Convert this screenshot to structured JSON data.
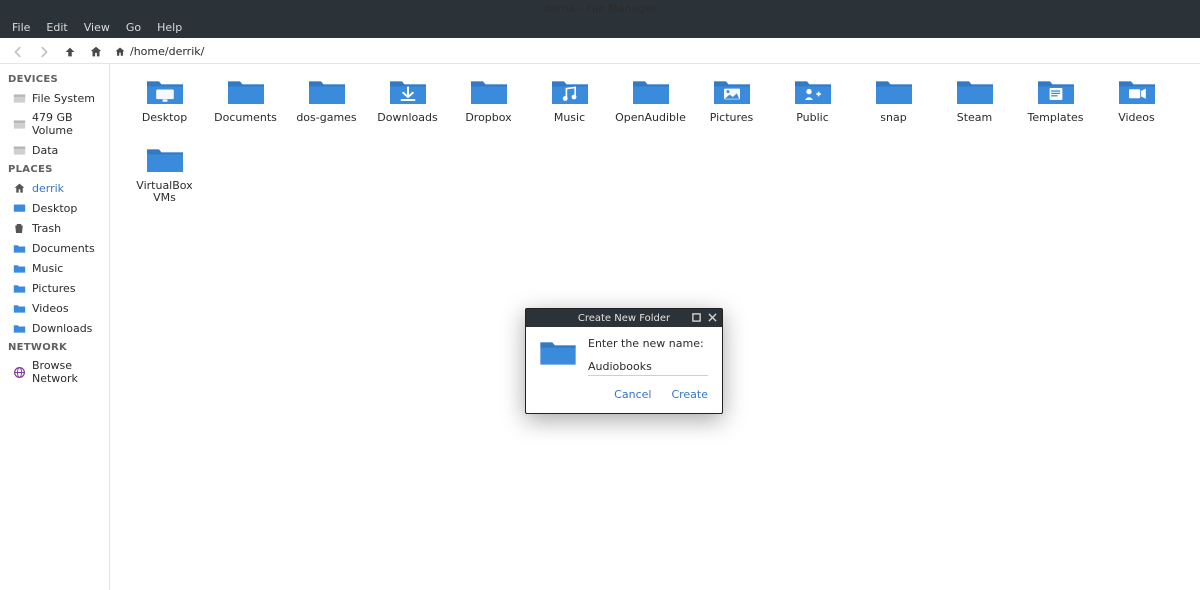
{
  "window_title": "derrik - File Manager",
  "menu": [
    "File",
    "Edit",
    "View",
    "Go",
    "Help"
  ],
  "path": "/home/derrik/",
  "sidebar": {
    "sections": [
      {
        "header": "DEVICES",
        "items": [
          {
            "label": "File System",
            "icon": "disk"
          },
          {
            "label": "479 GB Volume",
            "icon": "disk"
          },
          {
            "label": "Data",
            "icon": "disk"
          }
        ]
      },
      {
        "header": "PLACES",
        "items": [
          {
            "label": "derrik",
            "icon": "home",
            "selected": true
          },
          {
            "label": "Desktop",
            "icon": "desktop"
          },
          {
            "label": "Trash",
            "icon": "trash"
          },
          {
            "label": "Documents",
            "icon": "folder"
          },
          {
            "label": "Music",
            "icon": "folder"
          },
          {
            "label": "Pictures",
            "icon": "folder"
          },
          {
            "label": "Videos",
            "icon": "folder"
          },
          {
            "label": "Downloads",
            "icon": "folder"
          }
        ]
      },
      {
        "header": "NETWORK",
        "items": [
          {
            "label": "Browse Network",
            "icon": "network"
          }
        ]
      }
    ]
  },
  "folders": [
    {
      "label": "Desktop",
      "glyph": "desktop"
    },
    {
      "label": "Documents",
      "glyph": "plain"
    },
    {
      "label": "dos-games",
      "glyph": "plain"
    },
    {
      "label": "Downloads",
      "glyph": "download"
    },
    {
      "label": "Dropbox",
      "glyph": "plain"
    },
    {
      "label": "Music",
      "glyph": "music"
    },
    {
      "label": "OpenAudible",
      "glyph": "plain"
    },
    {
      "label": "Pictures",
      "glyph": "pictures"
    },
    {
      "label": "Public",
      "glyph": "public"
    },
    {
      "label": "snap",
      "glyph": "plain"
    },
    {
      "label": "Steam",
      "glyph": "plain"
    },
    {
      "label": "Templates",
      "glyph": "templates"
    },
    {
      "label": "Videos",
      "glyph": "videos"
    },
    {
      "label": "VirtualBox VMs",
      "glyph": "plain"
    }
  ],
  "dialog": {
    "title": "Create New Folder",
    "prompt": "Enter the new name:",
    "value": "Audiobooks",
    "cancel": "Cancel",
    "create": "Create"
  },
  "colors": {
    "folder": "#3b8bdd",
    "folder_dark": "#2f6fb3",
    "accent": "#3277c7"
  }
}
